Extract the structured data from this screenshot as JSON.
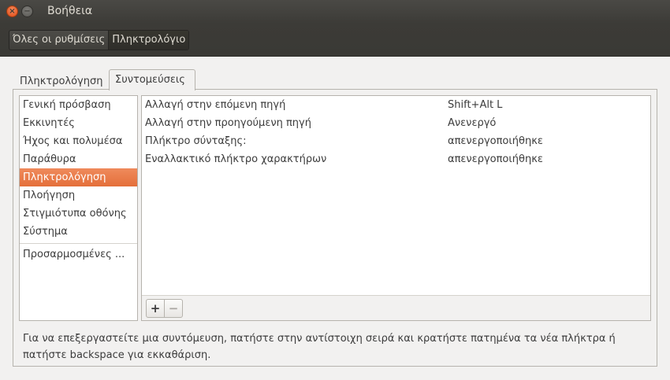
{
  "window": {
    "title": "Βοήθεια",
    "close_glyph": "×",
    "minimize_glyph": "−"
  },
  "toolbar": {
    "breadcrumbs": [
      {
        "label": "Όλες οι ρυθμίσεις"
      },
      {
        "label": "Πληκτρολόγιο"
      }
    ]
  },
  "tabs": [
    {
      "label": "Πληκτρολόγηση"
    },
    {
      "label": "Συντομεύσεις"
    }
  ],
  "categories": [
    {
      "label": "Γενική πρόσβαση"
    },
    {
      "label": "Εκκινητές"
    },
    {
      "label": "Ήχος και πολυμέσα"
    },
    {
      "label": "Παράθυρα"
    },
    {
      "label": "Πληκτρολόγηση"
    },
    {
      "label": "Πλοήγηση"
    },
    {
      "label": "Στιγμιότυπα οθόνης"
    },
    {
      "label": "Σύστημα"
    },
    {
      "label": "Προσαρμοσμένες ..."
    }
  ],
  "shortcuts": [
    {
      "name": "Αλλαγή στην επόμενη πηγή",
      "accel": "Shift+Alt L"
    },
    {
      "name": "Αλλαγή στην προηγούμενη πηγή",
      "accel": "Ανενεργό"
    },
    {
      "name": "Πλήκτρο σύνταξης:",
      "accel": "απενεργοποιήθηκε"
    },
    {
      "name": "Εναλλακτικό πλήκτρο χαρακτήρων",
      "accel": "απενεργοποιήθηκε"
    }
  ],
  "buttons": {
    "add": "+",
    "remove": "−"
  },
  "hint": "Για να επεξεργαστείτε μια συντόμευση, πατήστε στην αντίστοιχη σειρά και κρατήστε πατημένα τα νέα πλήκτρα ή πατήστε backspace για εκκαθάριση.",
  "colors": {
    "selection": "#e46f3a",
    "titlebar": "#3c3b37",
    "window_bg": "#f2f1f0"
  }
}
